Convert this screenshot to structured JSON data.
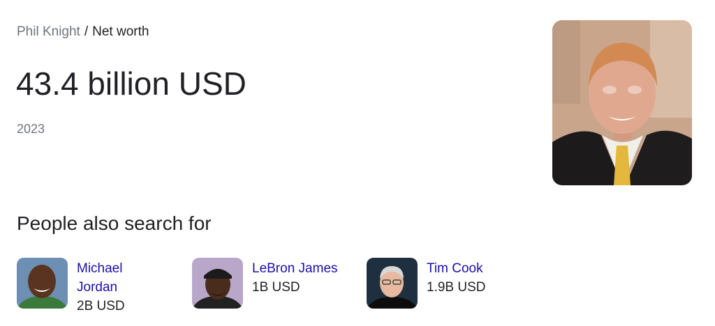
{
  "breadcrumb": {
    "parent": "Phil Knight",
    "separator": "/",
    "current": "Net worth"
  },
  "answer": {
    "value": "43.4 billion USD",
    "year": "2023"
  },
  "people_also_search": {
    "title": "People also search for",
    "people": [
      {
        "name": "Michael Jordan",
        "net_worth": "2B USD"
      },
      {
        "name": "LeBron James",
        "net_worth": "1B USD"
      },
      {
        "name": "Tim Cook",
        "net_worth": "1.9B USD"
      }
    ]
  },
  "colors": {
    "link": "#1a0dab",
    "muted": "#70757a",
    "text": "#202124"
  }
}
